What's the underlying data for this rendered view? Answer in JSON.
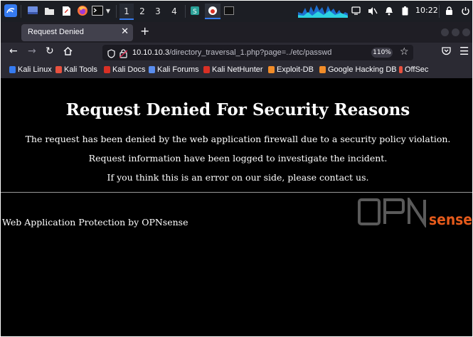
{
  "taskbar": {
    "workspaces": [
      "1",
      "2",
      "3",
      "4"
    ],
    "active_workspace": "1",
    "clock": "10:22"
  },
  "browser": {
    "tab_title": "Request Denied",
    "url_host": "10.10.10.3",
    "url_path": "/directory_traversal_1.php?page=../etc/passwd",
    "zoom": "110%",
    "bookmarks": [
      {
        "label": "Kali Linux",
        "color": "#367bf0"
      },
      {
        "label": "Kali Tools",
        "color": "#e8513f"
      },
      {
        "label": "Kali Docs",
        "color": "#d93025"
      },
      {
        "label": "Kali Forums",
        "color": "#5a8dee"
      },
      {
        "label": "Kali NetHunter",
        "color": "#d93025"
      },
      {
        "label": "Exploit-DB",
        "color": "#f28c28"
      },
      {
        "label": "Google Hacking DB",
        "color": "#f28c28"
      },
      {
        "label": "OffSec",
        "color": "#e8513f"
      }
    ]
  },
  "page": {
    "heading": "Request Denied For Security Reasons",
    "line1": "The request has been denied by the web application firewall due to a security policy violation.",
    "line2": "Request information have been logged to investigate the incident.",
    "line3": "If you think this is an error on our side, please contact us.",
    "protection": "Web Application Protection by OPNsense",
    "logo_opn": "OPN",
    "logo_sense": "sense"
  },
  "colors": {
    "accent": "#367bf0",
    "opnsense_orange": "#e55a1b",
    "page_bg": "#000000",
    "text": "#ffffff"
  }
}
